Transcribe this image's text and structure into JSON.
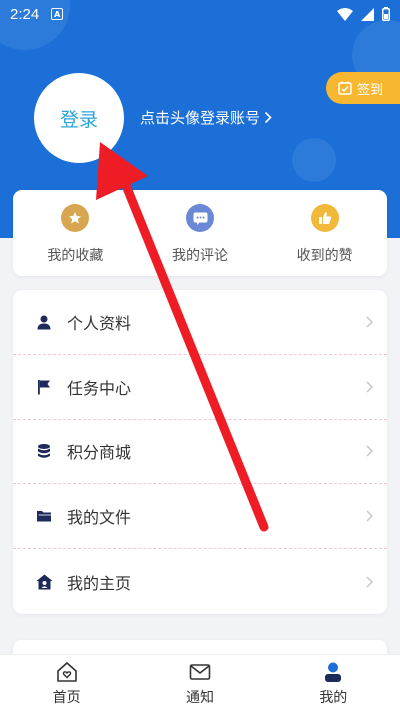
{
  "status": {
    "time": "2:24",
    "notif_letter": "A"
  },
  "profile": {
    "avatar_text": "登录",
    "login_hint": "点击头像登录账号",
    "checkin_label": "签到"
  },
  "quick_actions": [
    {
      "label": "我的收藏",
      "icon": "star-icon",
      "color": "#d8a550"
    },
    {
      "label": "我的评论",
      "icon": "comment-icon",
      "color": "#6b88d6"
    },
    {
      "label": "收到的赞",
      "icon": "thumbs-up-icon",
      "color": "#f1b83a"
    }
  ],
  "menu": [
    {
      "label": "个人资料",
      "icon": "person-icon"
    },
    {
      "label": "任务中心",
      "icon": "flag-icon"
    },
    {
      "label": "积分商城",
      "icon": "database-icon"
    },
    {
      "label": "我的文件",
      "icon": "folder-icon"
    },
    {
      "label": "我的主页",
      "icon": "home-icon"
    }
  ],
  "bottom_nav": [
    {
      "label": "首页",
      "icon": "home-heart-icon"
    },
    {
      "label": "通知",
      "icon": "mail-icon"
    },
    {
      "label": "我的",
      "icon": "user-icon",
      "active": true
    }
  ],
  "colors": {
    "header": "#1b6fd6",
    "accent": "#2aa3d9",
    "checkin": "#f7b731",
    "arrow": "#ee1c24",
    "menu_icon": "#1e2a5a"
  }
}
